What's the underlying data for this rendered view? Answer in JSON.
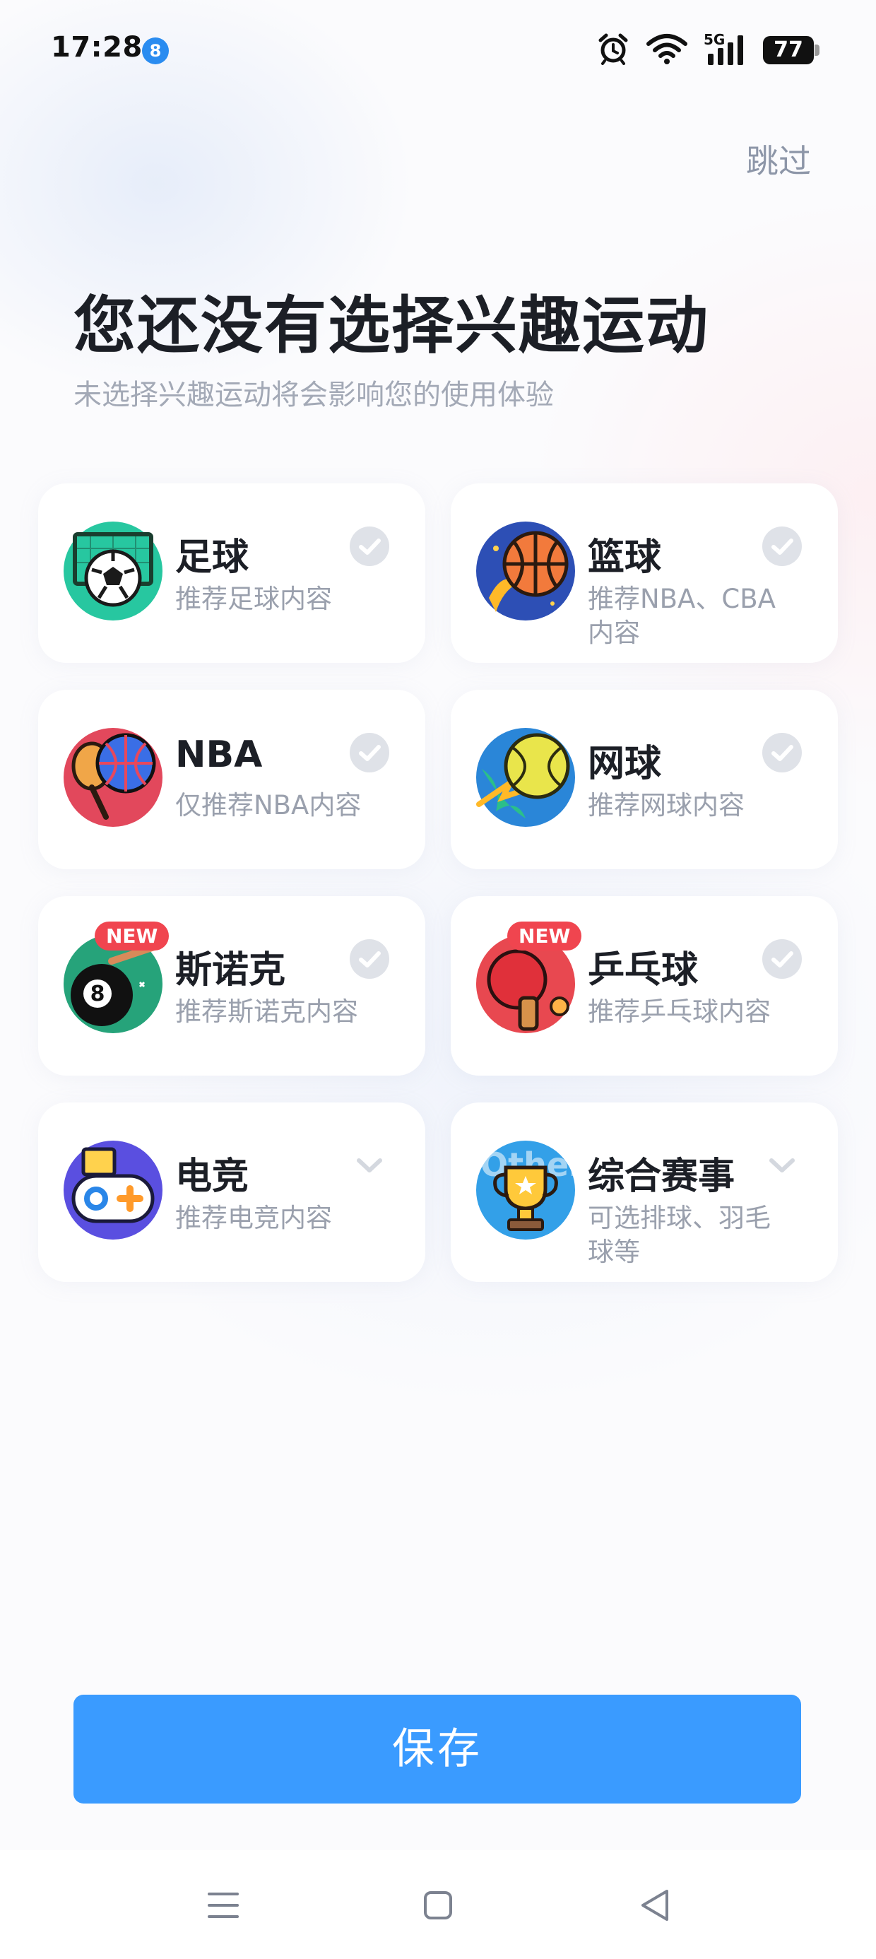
{
  "status_bar": {
    "time": "17:28",
    "app_icon": "app-badge-8",
    "network": "5G",
    "battery": "77"
  },
  "header": {
    "skip_label": "跳过",
    "title": "您还没有选择兴趣运动",
    "subtitle": "未选择兴趣运动将会影响您的使用体验"
  },
  "cards": [
    {
      "name": "足球",
      "desc": "推荐足球内容",
      "icon": "soccer-icon",
      "indicator": "check"
    },
    {
      "name": "篮球",
      "desc": "推荐NBA、CBA内容",
      "icon": "basketball-icon",
      "indicator": "check"
    },
    {
      "name": "NBA",
      "desc": "仅推荐NBA内容",
      "icon": "nba-icon",
      "indicator": "check"
    },
    {
      "name": "网球",
      "desc": "推荐网球内容",
      "icon": "tennis-icon",
      "indicator": "check"
    },
    {
      "name": "斯诺克",
      "desc": "推荐斯诺克内容",
      "icon": "snooker-icon",
      "indicator": "check",
      "badge": "NEW"
    },
    {
      "name": "乒乓球",
      "desc": "推荐乒乓球内容",
      "icon": "table-tennis-icon",
      "indicator": "check",
      "badge": "NEW"
    },
    {
      "name": "电竞",
      "desc": "推荐电竞内容",
      "icon": "esports-icon",
      "indicator": "chevron-down"
    },
    {
      "name": "综合赛事",
      "desc": "可选排球、羽毛球等",
      "icon": "trophy-icon",
      "indicator": "chevron-down",
      "icon_text": "Other"
    }
  ],
  "save_button": "保存",
  "colors": {
    "accent": "#3a9bff",
    "badge": "#f0454f",
    "title": "#1c1f26",
    "muted": "#9aa0ad"
  }
}
